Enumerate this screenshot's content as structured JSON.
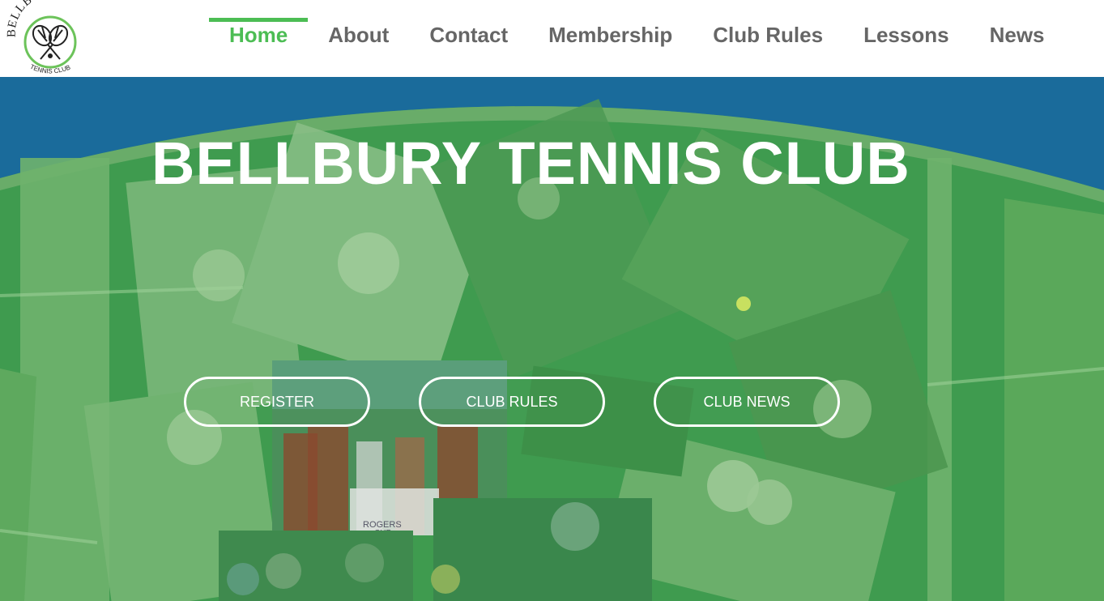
{
  "logo": {
    "arc_text": "BELLBURY",
    "sub_text": "TENNIS CLUB"
  },
  "nav": [
    {
      "label": "Home",
      "active": true
    },
    {
      "label": "About"
    },
    {
      "label": "Contact"
    },
    {
      "label": "Membership"
    },
    {
      "label": "Club Rules"
    },
    {
      "label": "Lessons"
    },
    {
      "label": "News"
    }
  ],
  "hero": {
    "title": "BELLBURY TENNIS CLUB",
    "buttons": [
      {
        "label": "REGISTER"
      },
      {
        "label": "CLUB RULES"
      },
      {
        "label": "CLUB NEWS"
      }
    ],
    "photo_text": {
      "badge": "ROGERS",
      "badge_sub": "CUP"
    }
  },
  "colors": {
    "accent_green": "#4cbd54",
    "nav_text": "#666666",
    "hero_blue": "#1e6f9a",
    "hero_green": "#3c9a4e"
  }
}
